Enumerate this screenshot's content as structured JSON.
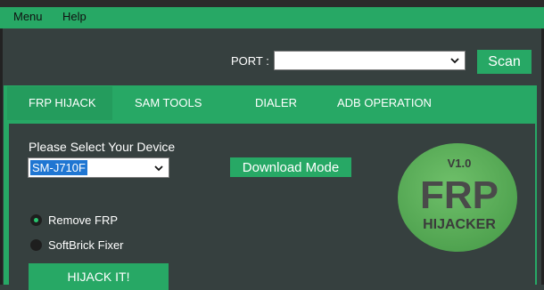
{
  "menu": {
    "items": [
      "Menu",
      "Help"
    ]
  },
  "port": {
    "label": "PORT :",
    "value": "",
    "scan_label": "Scan"
  },
  "tabs": [
    "FRP HIJACK",
    "SAM TOOLS",
    "DIALER",
    "ADB OPERATION"
  ],
  "main": {
    "device_label": "Please Select Your Device",
    "device_value": "SM-J710F",
    "download_label": "Download Mode",
    "options": [
      {
        "label": "Remove FRP",
        "selected": true
      },
      {
        "label": "SoftBrick Fixer",
        "selected": false
      }
    ],
    "hijack_label": "HIJACK IT!"
  },
  "logo": {
    "version": "V1.0",
    "title": "FRP",
    "subtitle": "HIJACKER"
  },
  "colors": {
    "accent": "#27a865",
    "background": "#36403f",
    "logo_circle": "#5fb35f"
  }
}
